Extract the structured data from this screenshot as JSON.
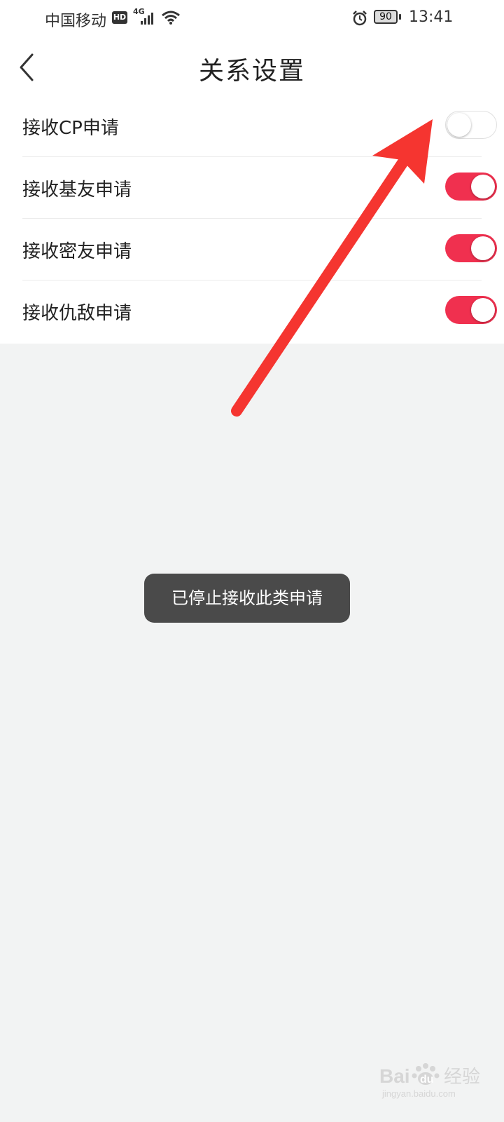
{
  "status_bar": {
    "carrier": "中国移动",
    "hd": "HD",
    "network": "4G",
    "battery": "90",
    "time": "13:41"
  },
  "header": {
    "title": "关系设置"
  },
  "settings": [
    {
      "label": "接收CP申请",
      "enabled": false
    },
    {
      "label": "接收基友申请",
      "enabled": true
    },
    {
      "label": "接收密友申请",
      "enabled": true
    },
    {
      "label": "接收仇敌申请",
      "enabled": true
    }
  ],
  "toast": {
    "message": "已停止接收此类申请"
  },
  "watermark": {
    "text": "Baidu经验",
    "url": "jingyan.baidu.com"
  },
  "colors": {
    "accent": "#f0304f",
    "arrow": "#f53530",
    "page_bg": "#f2f3f3"
  }
}
